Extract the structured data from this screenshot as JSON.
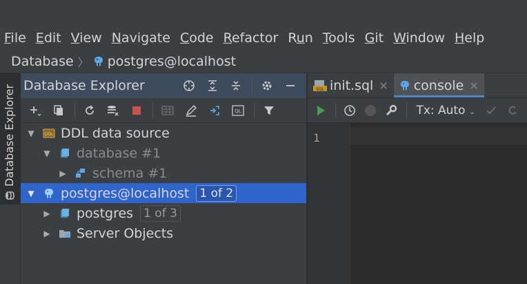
{
  "menu": {
    "items": [
      {
        "mnemonic": "F",
        "rest": "ile"
      },
      {
        "mnemonic": "E",
        "rest": "dit"
      },
      {
        "mnemonic": "V",
        "rest": "iew"
      },
      {
        "mnemonic": "N",
        "rest": "avigate"
      },
      {
        "mnemonic": "C",
        "rest": "ode"
      },
      {
        "mnemonic": "R",
        "rest": "efactor"
      },
      {
        "mnemonic": "",
        "pre": "R",
        "mid": "u",
        "rest": "n"
      },
      {
        "mnemonic": "T",
        "rest": "ools"
      },
      {
        "mnemonic": "G",
        "rest": "it"
      },
      {
        "mnemonic": "W",
        "rest": "indow"
      },
      {
        "mnemonic": "H",
        "rest": "elp"
      }
    ]
  },
  "breadcrumb": {
    "root": "Database",
    "separator": "〉",
    "current": "postgres@localhost"
  },
  "side_strip": {
    "label": "Database Explorer"
  },
  "explorer": {
    "title": "Database Explorer",
    "tree": [
      {
        "label": "DDL data source",
        "badge": ""
      },
      {
        "label": "database #1",
        "badge": ""
      },
      {
        "label": "schema #1",
        "badge": ""
      },
      {
        "label": "postgres@localhost",
        "badge": "1 of 2"
      },
      {
        "label": "postgres",
        "badge": "1 of 3"
      },
      {
        "label": "Server Objects",
        "badge": ""
      }
    ]
  },
  "editor": {
    "tabs": [
      {
        "label": "init.sql",
        "close": "×"
      },
      {
        "label": "console",
        "close": "×"
      }
    ],
    "tx_mode": "Tx: Auto",
    "line_numbers": [
      "1"
    ]
  },
  "colors": {
    "selection": "#2f65ca",
    "accent_tab": "#4a88c7",
    "run_green": "#499c54",
    "stop_red": "#c75450"
  }
}
